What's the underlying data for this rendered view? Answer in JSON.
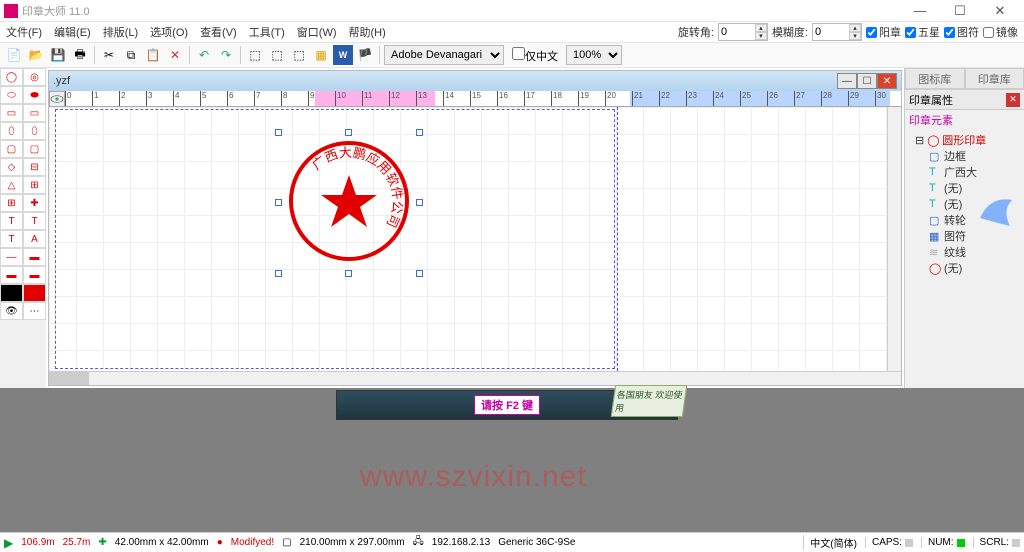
{
  "title": "印章大师 11.0",
  "menu": [
    "文件(F)",
    "编辑(E)",
    "排版(L)",
    "选项(O)",
    "查看(V)",
    "工具(T)",
    "窗口(W)",
    "帮助(H)"
  ],
  "rotation": {
    "label": "旋转角:",
    "value": "0"
  },
  "blur": {
    "label": "模糊度:",
    "value": "0"
  },
  "checks": {
    "yang": "阳章",
    "star": "五星",
    "tufu": "图符",
    "mirror": "镜像"
  },
  "font": "Adobe Devanagari",
  "cn_only": "仅中文",
  "zoom": "100%",
  "doc_title": ".yzf",
  "right_tabs": [
    "图标库",
    "印章库"
  ],
  "prop_title": "印章属性",
  "prop_section": "印章元素",
  "tree": {
    "root": "圆形印章",
    "items": [
      "边框",
      "广西大",
      "(无)",
      "(无)",
      "转轮",
      "图符",
      "纹线",
      "(无)"
    ]
  },
  "seal_text": "广西大鹏应用软件公司",
  "banner_f2": "请按 F2 键",
  "banner_welcome": "各国朋友 欢迎使用",
  "status": {
    "x": "106.9m",
    "y": "25.7m",
    "size": "42.00mm x 42.00mm",
    "mod": "Modifyed!",
    "page": "210.00mm x 297.00mm",
    "ip": "192.168.2.13",
    "printer": "Generic 36C-9Se",
    "lang": "中文(简体)",
    "caps": "CAPS:",
    "num": "NUM:",
    "scrl": "SCRL:"
  },
  "watermark": "www.szvixin.net"
}
